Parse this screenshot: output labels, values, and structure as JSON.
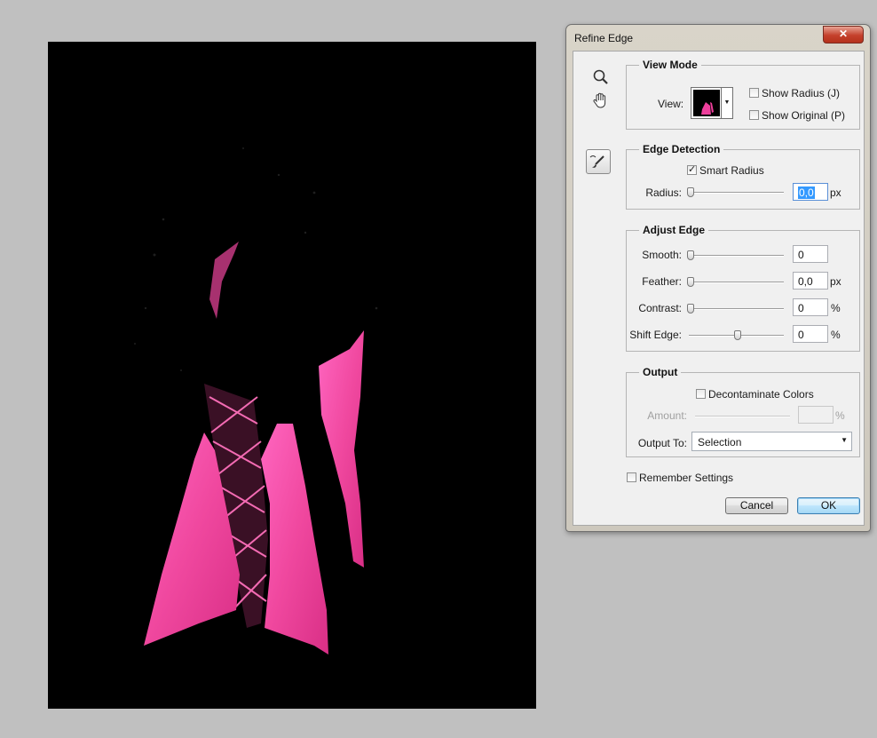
{
  "dialog": {
    "title": "Refine Edge",
    "close_glyph": "✕"
  },
  "tools": [
    "zoom-tool-icon",
    "hand-tool-icon",
    "refine-radius-brush-icon"
  ],
  "view_mode": {
    "heading": "View Mode",
    "view_label": "View:",
    "show_radius": {
      "label": "Show Radius (J)",
      "checked": false
    },
    "show_original": {
      "label": "Show Original (P)",
      "checked": false
    }
  },
  "edge_detection": {
    "heading": "Edge Detection",
    "smart_radius": {
      "label": "Smart Radius",
      "checked": true
    },
    "radius_label": "Radius:",
    "radius_value": "0,0",
    "radius_unit": "px",
    "radius_level": 0
  },
  "adjust_edge": {
    "heading": "Adjust Edge",
    "smooth": {
      "label": "Smooth:",
      "value": "0",
      "unit": "",
      "level": 0
    },
    "feather": {
      "label": "Feather:",
      "value": "0,0",
      "unit": "px",
      "level": 0
    },
    "contrast": {
      "label": "Contrast:",
      "value": "0",
      "unit": "%",
      "level": 0
    },
    "shift_edge": {
      "label": "Shift Edge:",
      "value": "0",
      "unit": "%",
      "level": 0.5
    }
  },
  "output": {
    "heading": "Output",
    "decontaminate": {
      "label": "Decontaminate Colors",
      "checked": false
    },
    "amount_label": "Amount:",
    "amount_unit": "%",
    "output_to_label": "Output To:",
    "output_to_value": "Selection"
  },
  "remember_settings": {
    "label": "Remember Settings",
    "checked": false
  },
  "buttons": {
    "cancel": "Cancel",
    "ok": "OK"
  },
  "colors": {
    "selection_pink": "#ee3f9c",
    "canvas_background": "#000000",
    "workspace": "#c0c0c0"
  }
}
